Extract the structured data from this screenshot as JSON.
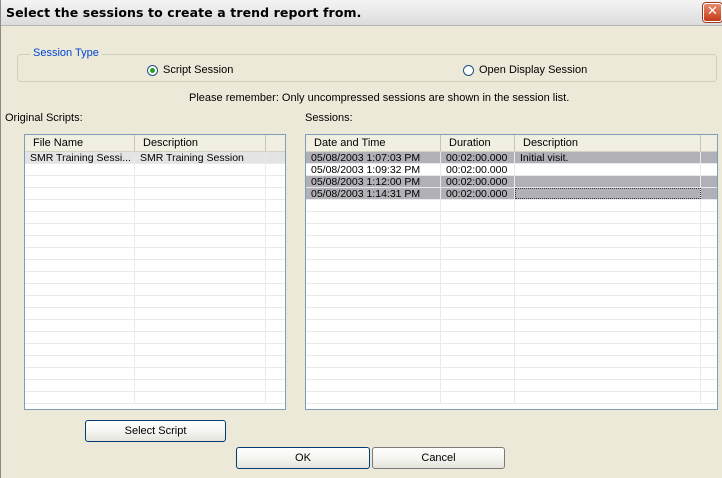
{
  "window": {
    "title": "Select the sessions to create a trend report from.",
    "close_glyph": "✕"
  },
  "session_type": {
    "legend": "Session Type",
    "options": [
      {
        "label": "Script Session",
        "checked": true
      },
      {
        "label": "Open Display Session",
        "checked": false
      }
    ]
  },
  "notice": "Please remember: Only uncompressed sessions are shown in the session list.",
  "original_scripts": {
    "label": "Original Scripts:",
    "columns": [
      "File Name",
      "Description"
    ],
    "rows": [
      [
        "SMR Training Sessi...",
        "SMR Training Session"
      ]
    ]
  },
  "sessions": {
    "label": "Sessions:",
    "columns": [
      "Date and Time",
      "Duration",
      "Description"
    ],
    "rows": [
      [
        "05/08/2003 1:07:03 PM",
        "00:02:00.000",
        "Initial visit."
      ],
      [
        "05/08/2003 1:09:32 PM",
        "00:02:00.000",
        ""
      ],
      [
        "05/08/2003 1:12:00 PM",
        "00:02:00.000",
        ""
      ],
      [
        "05/08/2003 1:14:31 PM",
        "00:02:00.000",
        ""
      ]
    ],
    "selected_rows": [
      0,
      2,
      3
    ]
  },
  "buttons": {
    "select_script": "Select Script",
    "ok": "OK",
    "cancel": "Cancel"
  }
}
